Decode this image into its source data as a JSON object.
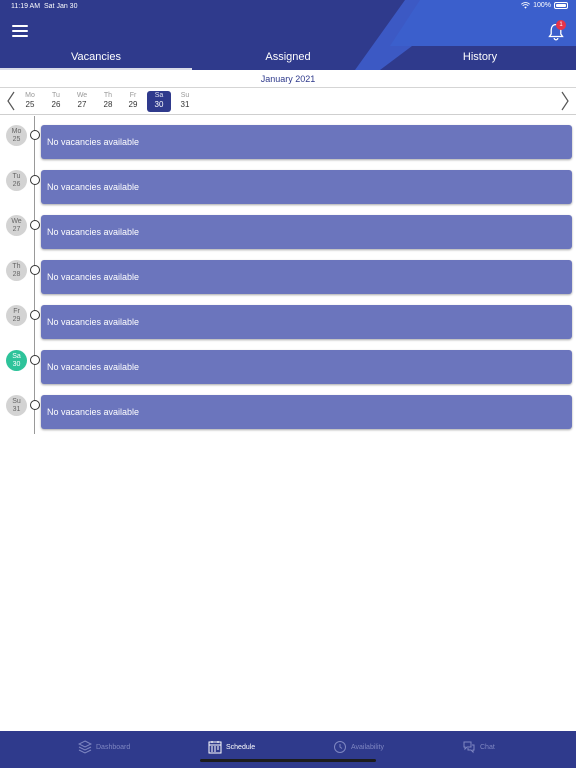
{
  "status_bar": {
    "time": "11:19 AM",
    "date": "Sat Jan 30",
    "battery": "100%"
  },
  "header": {
    "notification_count": "1",
    "tabs": [
      {
        "label": "Vacancies",
        "active": true
      },
      {
        "label": "Assigned",
        "active": false
      },
      {
        "label": "History",
        "active": false
      }
    ]
  },
  "month_label": "January 2021",
  "week": [
    {
      "abbr": "Mo",
      "num": "25"
    },
    {
      "abbr": "Tu",
      "num": "26"
    },
    {
      "abbr": "We",
      "num": "27"
    },
    {
      "abbr": "Th",
      "num": "28"
    },
    {
      "abbr": "Fr",
      "num": "29"
    },
    {
      "abbr": "Sa",
      "num": "30",
      "selected": true
    },
    {
      "abbr": "Su",
      "num": "31"
    }
  ],
  "days": [
    {
      "abbr": "Mo",
      "num": "25",
      "message": "No vacancies available"
    },
    {
      "abbr": "Tu",
      "num": "26",
      "message": "No vacancies available"
    },
    {
      "abbr": "We",
      "num": "27",
      "message": "No vacancies available"
    },
    {
      "abbr": "Th",
      "num": "28",
      "message": "No vacancies available"
    },
    {
      "abbr": "Fr",
      "num": "29",
      "message": "No vacancies available"
    },
    {
      "abbr": "Sa",
      "num": "30",
      "message": "No vacancies available",
      "today": true
    },
    {
      "abbr": "Su",
      "num": "31",
      "message": "No vacancies available"
    }
  ],
  "bottom_nav": [
    {
      "label": "Dashboard",
      "icon": "dashboard-icon",
      "active": false
    },
    {
      "label": "Schedule",
      "icon": "calendar-icon",
      "active": true
    },
    {
      "label": "Availability",
      "icon": "availability-icon",
      "active": false
    },
    {
      "label": "Chat",
      "icon": "chat-icon",
      "active": false
    }
  ],
  "colors": {
    "primary": "#2f3a8c",
    "card": "#6b75bd",
    "today": "#2ec39a",
    "badge": "#e5344a"
  }
}
